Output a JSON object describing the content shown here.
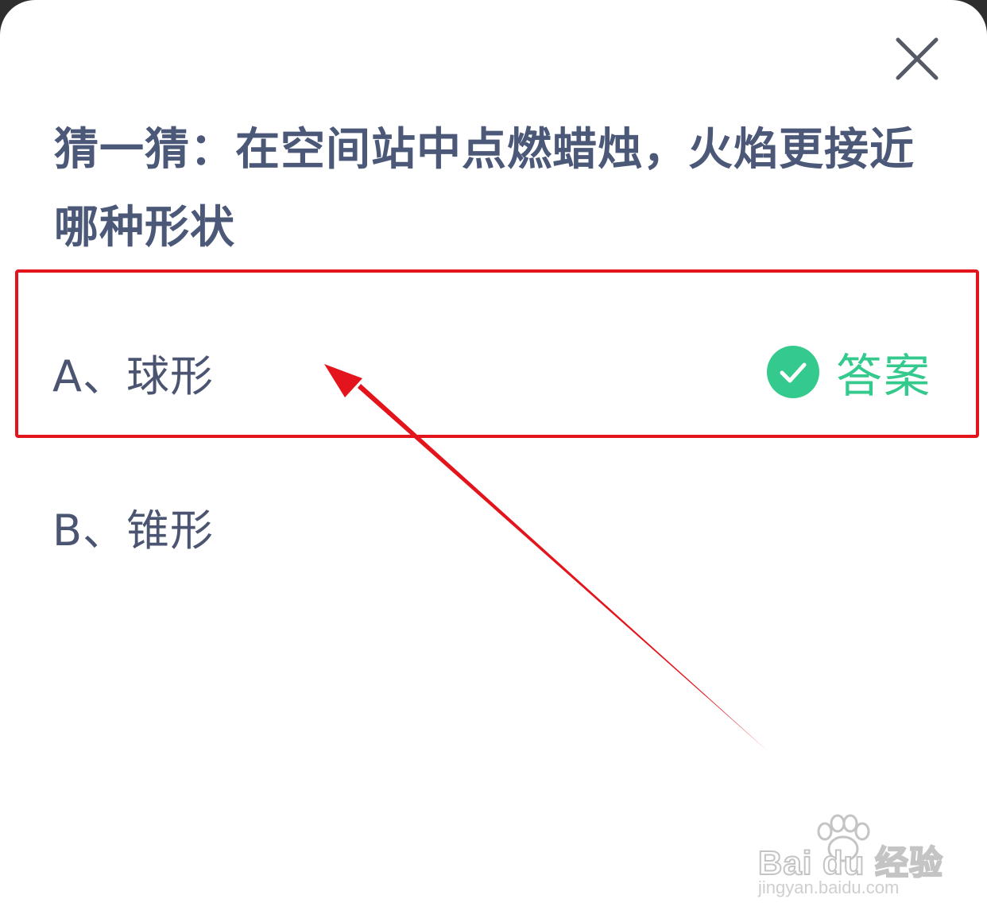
{
  "dialog": {
    "question": "猜一猜：在空间站中点燃蜡烛，火焰更接近哪种形状",
    "close_icon": "close-icon"
  },
  "options": [
    {
      "label": "A、球形",
      "is_answer": true,
      "badge_icon": "check-circle-icon",
      "badge_text": "答案"
    },
    {
      "label": "B、锥形",
      "is_answer": false
    }
  ],
  "colors": {
    "question_text": "#4b5878",
    "option_text": "#4b5572",
    "answer_green": "#34c98d",
    "annotation_red": "#e3141c"
  },
  "watermark": {
    "brand": "Bai du 经验",
    "url": "jingyan.baidu.com"
  }
}
